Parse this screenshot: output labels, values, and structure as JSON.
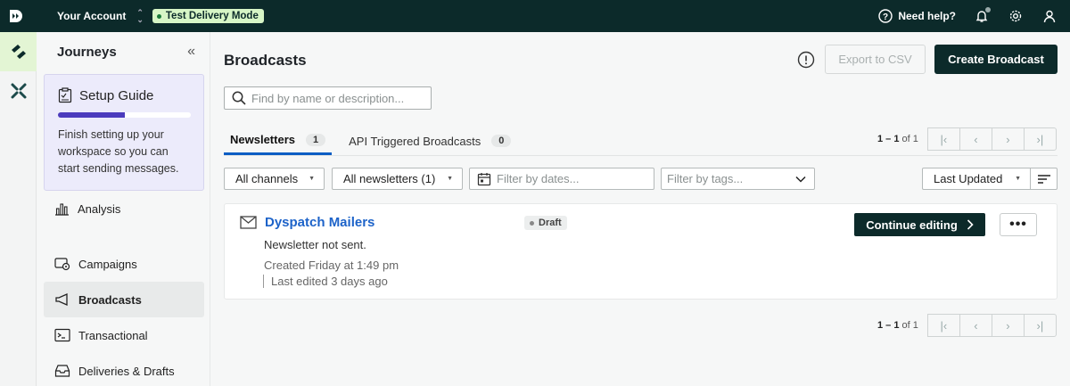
{
  "topbar": {
    "account_label": "Your Account",
    "mode_badge": "Test Delivery Mode",
    "help_label": "Need help?"
  },
  "sidebar": {
    "title": "Journeys",
    "setup_guide": {
      "title": "Setup Guide",
      "progress": 0.5,
      "text": "Finish setting up your workspace so you can start sending messages."
    },
    "items": [
      {
        "label": "Analysis",
        "icon": "bar-chart-icon"
      },
      {
        "label": "Campaigns",
        "icon": "campaign-icon"
      },
      {
        "label": "Broadcasts",
        "icon": "megaphone-icon",
        "active": true
      },
      {
        "label": "Transactional",
        "icon": "terminal-icon"
      },
      {
        "label": "Deliveries & Drafts",
        "icon": "inbox-icon"
      }
    ]
  },
  "main": {
    "title": "Broadcasts",
    "export_label": "Export to CSV",
    "create_label": "Create Broadcast",
    "search_placeholder": "Find by name or description...",
    "tabs": [
      {
        "label": "Newsletters",
        "count": "1"
      },
      {
        "label": "API Triggered Broadcasts",
        "count": "0"
      }
    ],
    "pager": {
      "range": "1 – 1",
      "of": "of 1"
    },
    "filters": {
      "channels": "All channels",
      "newsletters": "All newsletters (1)",
      "dates_placeholder": "Filter by dates...",
      "tags_placeholder": "Filter by tags...",
      "sort": "Last Updated"
    },
    "card": {
      "title": "Dyspatch Mailers",
      "status": "Draft",
      "sent_status": "Newsletter not sent.",
      "created": "Created Friday at 1:49 pm",
      "edited": "Last edited 3 days ago",
      "continue_label": "Continue editing"
    }
  }
}
